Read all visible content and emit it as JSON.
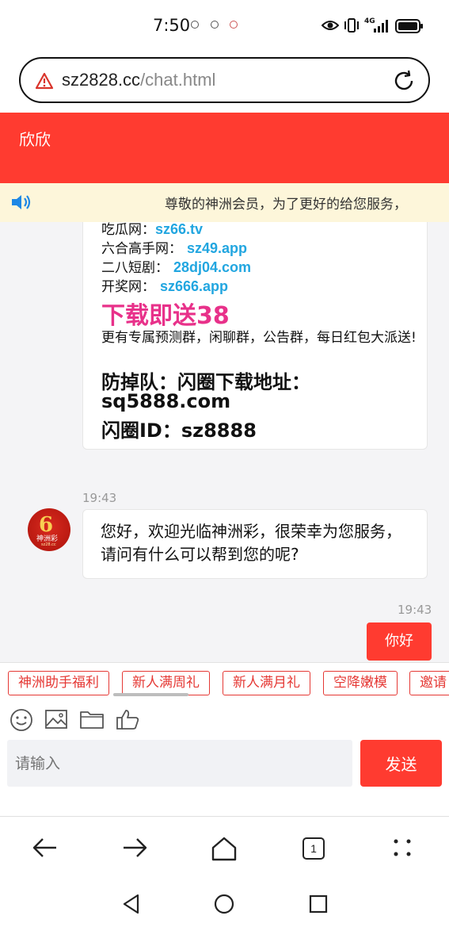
{
  "status": {
    "time": "7:50",
    "network": "4G"
  },
  "browser": {
    "url_domain": "sz2828.cc",
    "url_path": "/chat.html",
    "tab_count": "1"
  },
  "chat": {
    "title": "欣欣",
    "notice": "尊敬的神洲会员，为了更好的给您服务，",
    "promo": {
      "lines": [
        {
          "label": "吃瓜网：",
          "link": "sz66.tv"
        },
        {
          "label": "六合高手网：",
          "link": "sz49.app"
        },
        {
          "label": "二八短剧：",
          "link": "28dj04.com"
        },
        {
          "label": "开奖网：",
          "link": "sz666.app"
        }
      ],
      "headline": "下载即送38",
      "desc": "更有专属预测群，闲聊群，公告群，每日红包大派送!",
      "big_lines": [
        "防掉队：闪圈下载地址：",
        "sq5888.com",
        "闪圈ID：sz8888"
      ]
    },
    "bot_message": {
      "time": "19:43",
      "text": "您好，欢迎光临神洲彩，很荣幸为您服务，请问有什么可以帮到您的呢?"
    },
    "bot_avatar": {
      "brand": "神洲彩",
      "domain": "sz28.cc"
    },
    "user_message": {
      "time": "19:43",
      "text": "你好"
    }
  },
  "quick_replies": [
    "神洲助手福利",
    "新人满周礼",
    "新人满月礼",
    "空降嫩模",
    "邀请"
  ],
  "toolbar": [
    "emoji-icon",
    "image-icon",
    "folder-icon",
    "thumbs-up-icon"
  ],
  "composer": {
    "placeholder": "请输入",
    "send_label": "发送"
  },
  "colors": {
    "accent": "#ff3b30",
    "link": "#22a6e0",
    "headline": "#e8318a",
    "notice_bg": "#fdf6da"
  }
}
